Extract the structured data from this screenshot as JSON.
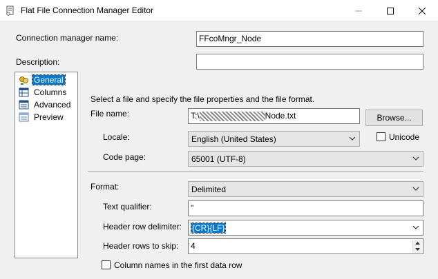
{
  "window": {
    "title": "Flat File Connection Manager Editor"
  },
  "top": {
    "conn_name_label": "Connection manager name:",
    "conn_name_value": "FFcoMngr_Node",
    "description_label": "Description:",
    "description_value": ""
  },
  "nav": {
    "items": [
      {
        "label": "General",
        "icon": "general-icon",
        "selected": true
      },
      {
        "label": "Columns",
        "icon": "columns-icon"
      },
      {
        "label": "Advanced",
        "icon": "advanced-icon"
      },
      {
        "label": "Preview",
        "icon": "preview-icon"
      }
    ]
  },
  "general": {
    "intro": "Select a file and specify the file properties and the file format.",
    "file_name_label": "File name:",
    "file_name_prefix": "T:\\",
    "file_name_suffix": "Node.txt",
    "browse_label": "Browse...",
    "locale_label": "Locale:",
    "locale_value": "English (United States)",
    "unicode_label": "Unicode",
    "code_page_label": "Code page:",
    "code_page_value": "65001 (UTF-8)",
    "format_label": "Format:",
    "format_value": "Delimited",
    "text_qualifier_label": "Text qualifier:",
    "text_qualifier_value": "\"",
    "header_row_delim_label": "Header row delimiter:",
    "header_row_delim_value": "{CR}{LF}",
    "header_rows_skip_label": "Header rows to skip:",
    "header_rows_skip_value": "4",
    "column_names_label": "Column names in the first data row"
  }
}
